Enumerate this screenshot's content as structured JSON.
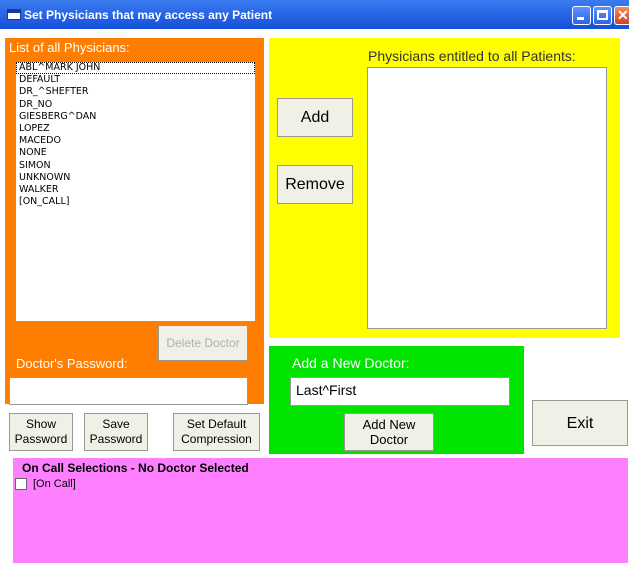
{
  "window": {
    "title": "Set Physicians that may access any Patient",
    "controls": [
      "minimize-icon",
      "maximize-icon",
      "close-icon"
    ]
  },
  "physicians": {
    "label": "List of all Physicians:",
    "items": [
      "ABL^MARK JOHN",
      "DEFAULT",
      "DR_^SHEFTER",
      "DR_NO",
      "GIESBERG^DAN",
      "LOPEZ",
      "MACEDO",
      "NONE",
      "SIMON",
      "UNKNOWN",
      "WALKER",
      "[ON_CALL]"
    ],
    "delete_label": "Delete Doctor"
  },
  "entitled": {
    "label": "Physicians entitled to all Patients:",
    "items": [],
    "add_label": "Add",
    "remove_label": "Remove"
  },
  "password": {
    "label": "Doctor's Password:",
    "value": "",
    "show_label": "Show Password",
    "save_label": "Save Password",
    "compression_label": "Set Default Compression"
  },
  "new_doctor": {
    "label": "Add a New Doctor:",
    "value": "Last^First",
    "add_label": "Add New Doctor"
  },
  "exit_label": "Exit",
  "on_call": {
    "title": "On Call Selections - No Doctor Selected",
    "option_label": "[On Call]",
    "checked": false
  }
}
